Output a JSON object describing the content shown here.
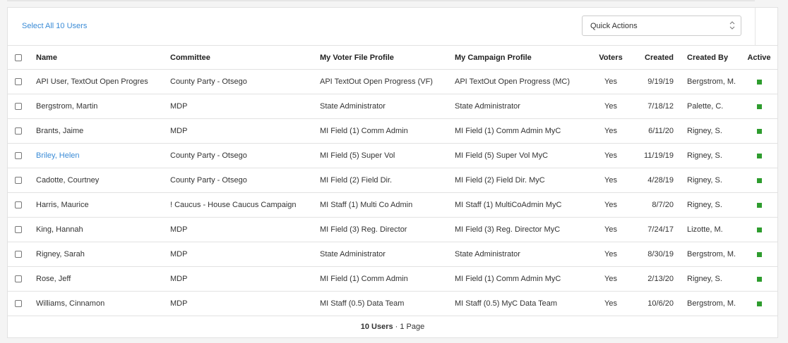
{
  "toolbar": {
    "select_all_label": "Select All 10 Users",
    "quick_actions_label": "Quick Actions"
  },
  "columns": {
    "name": "Name",
    "committee": "Committee",
    "voter_file_profile": "My Voter File Profile",
    "campaign_profile": "My Campaign Profile",
    "voters": "Voters",
    "created": "Created",
    "created_by": "Created By",
    "active": "Active"
  },
  "rows": [
    {
      "name": "API User, TextOut Open Progres",
      "committee": "County Party - Otsego",
      "vf": "API TextOut Open Progress (VF)",
      "mc": "API TextOut Open Progress (MC)",
      "voters": "Yes",
      "created": "9/19/19",
      "by": "Bergstrom, M.",
      "active": true,
      "highlight": false
    },
    {
      "name": "Bergstrom, Martin",
      "committee": "MDP",
      "vf": "State Administrator",
      "mc": "State Administrator",
      "voters": "Yes",
      "created": "7/18/12",
      "by": "Palette, C.",
      "active": true,
      "highlight": false
    },
    {
      "name": "Brants, Jaime",
      "committee": "MDP",
      "vf": "MI Field (1) Comm Admin",
      "mc": "MI Field (1) Comm Admin MyC",
      "voters": "Yes",
      "created": "6/11/20",
      "by": "Rigney, S.",
      "active": true,
      "highlight": false
    },
    {
      "name": "Briley, Helen",
      "committee": "County Party - Otsego",
      "vf": "MI Field (5) Super Vol",
      "mc": "MI Field (5) Super Vol MyC",
      "voters": "Yes",
      "created": "11/19/19",
      "by": "Rigney, S.",
      "active": true,
      "highlight": true
    },
    {
      "name": "Cadotte, Courtney",
      "committee": "County Party - Otsego",
      "vf": "MI Field (2) Field Dir.",
      "mc": "MI Field (2) Field Dir. MyC",
      "voters": "Yes",
      "created": "4/28/19",
      "by": "Rigney, S.",
      "active": true,
      "highlight": false
    },
    {
      "name": "Harris, Maurice",
      "committee": "! Caucus - House Caucus Campaign",
      "vf": "MI Staff (1) Multi Co Admin",
      "mc": "MI Staff (1) MultiCoAdmin MyC",
      "voters": "Yes",
      "created": "8/7/20",
      "by": "Rigney, S.",
      "active": true,
      "highlight": false
    },
    {
      "name": "King, Hannah",
      "committee": "MDP",
      "vf": "MI Field (3) Reg. Director",
      "mc": "MI Field (3) Reg. Director MyC",
      "voters": "Yes",
      "created": "7/24/17",
      "by": "Lizotte, M.",
      "active": true,
      "highlight": false
    },
    {
      "name": "Rigney, Sarah",
      "committee": "MDP",
      "vf": "State Administrator",
      "mc": "State Administrator",
      "voters": "Yes",
      "created": "8/30/19",
      "by": "Bergstrom, M.",
      "active": true,
      "highlight": false
    },
    {
      "name": "Rose, Jeff",
      "committee": "MDP",
      "vf": "MI Field (1) Comm Admin",
      "mc": "MI Field (1) Comm Admin MyC",
      "voters": "Yes",
      "created": "2/13/20",
      "by": "Rigney, S.",
      "active": true,
      "highlight": false
    },
    {
      "name": "Williams, Cinnamon",
      "committee": "MDP",
      "vf": "MI Staff (0.5) Data Team",
      "mc": "MI Staff (0.5) MyC Data Team",
      "voters": "Yes",
      "created": "10/6/20",
      "by": "Bergstrom, M.",
      "active": true,
      "highlight": false
    }
  ],
  "footer": {
    "users_count": "10 Users",
    "pages": " · 1 Page"
  },
  "colors": {
    "link": "#3a8bd6",
    "active": "#2e9c2e"
  }
}
